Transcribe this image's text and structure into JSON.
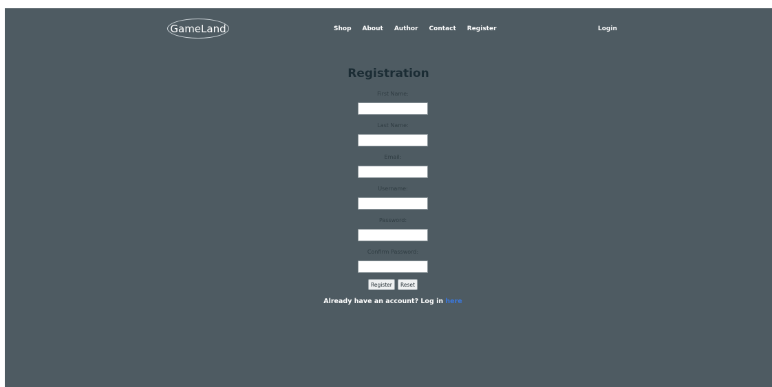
{
  "header": {
    "logo_text": "GameLand",
    "nav": [
      {
        "label": "Shop"
      },
      {
        "label": "About"
      },
      {
        "label": "Author"
      },
      {
        "label": "Contact"
      },
      {
        "label": "Register"
      }
    ],
    "login_label": "Login"
  },
  "form": {
    "title": "Registration",
    "fields": [
      {
        "label": "First Name:",
        "value": ""
      },
      {
        "label": "Last Name:",
        "value": ""
      },
      {
        "label": "Email:",
        "value": ""
      },
      {
        "label": "Username:",
        "value": ""
      },
      {
        "label": "Password:",
        "value": ""
      },
      {
        "label": "Confirm Password:",
        "value": ""
      }
    ],
    "register_button": "Register",
    "reset_button": "Reset",
    "login_prompt": "Already have an account? Log in ",
    "login_link": "here"
  },
  "colors": {
    "background": "#4e5b62",
    "title": "#1b2c34",
    "link": "#3a78e0"
  }
}
